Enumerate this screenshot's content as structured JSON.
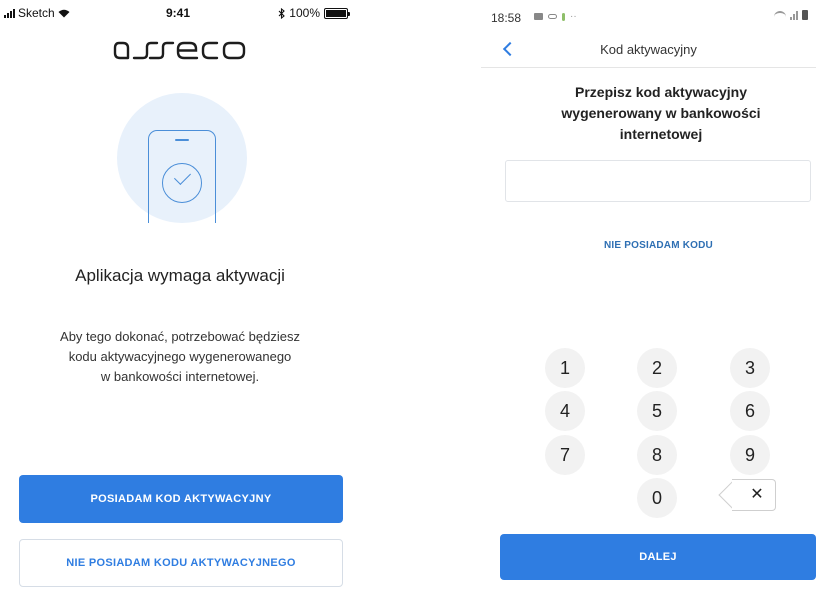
{
  "left_screen": {
    "status_bar": {
      "carrier": "Sketch",
      "time": "9:41",
      "battery": "100%"
    },
    "logo": "asseco",
    "title": "Aplikacja wymaga aktywacji",
    "description_lines": [
      "Aby tego dokonać, potrzebować będziesz",
      "kodu aktywacyjnego wygenerowanego",
      "w bankowości internetowej."
    ],
    "primary_button": "POSIADAM KOD AKTYWACYJNY",
    "secondary_button": "NIE POSIADAM KODU AKTYWACYJNEGO",
    "illustration_icon": "phone-check-icon"
  },
  "right_screen": {
    "status_bar": {
      "time": "18:58",
      "extra": "··"
    },
    "nav_title": "Kod aktywacyjny",
    "back_icon": "chevron-left-icon",
    "heading_lines": [
      "Przepisz kod aktywacyjny",
      "wygenerowany w bankowości",
      "internetowej"
    ],
    "code_input": {
      "value": "",
      "placeholder": ""
    },
    "no_code_link": "NIE POSIADAM KODU",
    "keypad": [
      "1",
      "2",
      "3",
      "4",
      "5",
      "6",
      "7",
      "8",
      "9",
      "0"
    ],
    "backspace_label": "✕",
    "submit_button": "DALEJ"
  },
  "colors": {
    "accent": "#2f7de1",
    "link": "#2e6fb3",
    "illustration_bg": "#e8f1fb",
    "key_bg": "#f2f2f2"
  }
}
